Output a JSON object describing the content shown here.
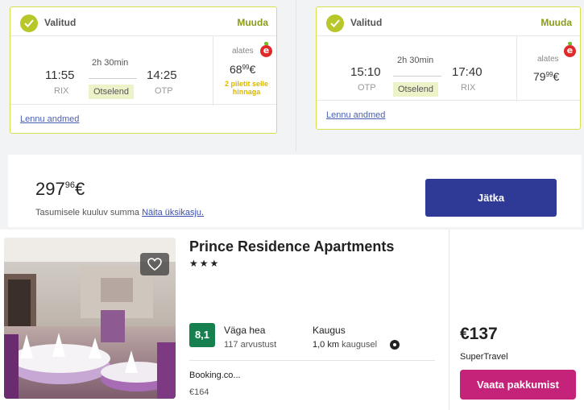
{
  "flights": [
    {
      "status": "Valitud",
      "change": "Muuda",
      "depart_time": "11:55",
      "depart_code": "RIX",
      "arrive_time": "14:25",
      "arrive_code": "OTP",
      "duration": "2h 30min",
      "stops": "Otselend",
      "price_from": "alates",
      "price_main": "68",
      "price_cents": "99",
      "currency": "€",
      "seats_note_1": "2 piletit selle",
      "seats_note_2": "hinnaga",
      "details_link": "Lennu andmed"
    },
    {
      "status": "Valitud",
      "change": "Muuda",
      "depart_time": "15:10",
      "depart_code": "OTP",
      "arrive_time": "17:40",
      "arrive_code": "RIX",
      "duration": "2h 30min",
      "stops": "Otselend",
      "price_from": "alates",
      "price_main": "79",
      "price_cents": "99",
      "currency": "€",
      "details_link": "Lennu andmed"
    }
  ],
  "total": {
    "price_main": "297",
    "price_cents": "96",
    "currency": "€",
    "note": "Tasumisele kuuluv summa",
    "breakdown_link": "Näita üksikasju.",
    "continue_label": "Jätka"
  },
  "hotel": {
    "name": "Prince Residence Apartments",
    "stars": "★★★",
    "rating": "8,1",
    "rating_label": "Väga hea",
    "reviews": "117 arvustust",
    "distance_label": "Kaugus",
    "distance_value": "1,0 km",
    "distance_suffix": "kaugusel",
    "provider": "Booking.co...",
    "provider_price": "€164",
    "best_price": "€137",
    "best_provider": "SuperTravel",
    "offer_label": "Vaata pakkumist"
  },
  "colors": {
    "accent_green": "#b7c72a",
    "continue_button": "#2e3a96",
    "offer_button": "#c5237a",
    "rating_green": "#17804f"
  },
  "icons": [
    "check-icon",
    "e-logo-icon",
    "heart-icon",
    "target-icon"
  ]
}
